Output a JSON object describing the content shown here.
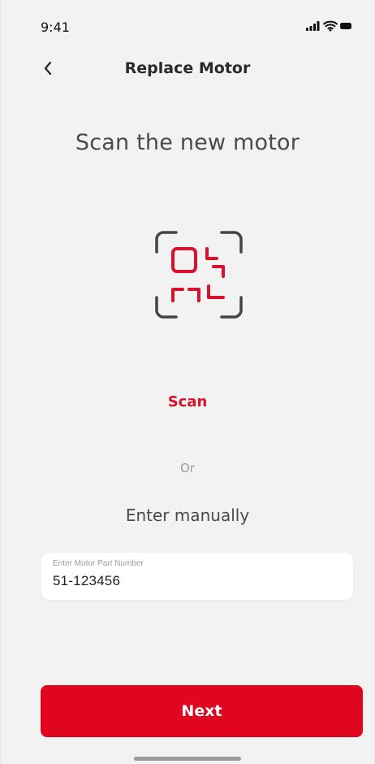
{
  "status_bar": {
    "time": "9:41",
    "icons": [
      "signal-icon",
      "wifi-icon",
      "battery-icon"
    ]
  },
  "header": {
    "title": "Replace Motor",
    "back_icon": "chevron-left-icon"
  },
  "main": {
    "title": "Scan the new motor",
    "scan_icon": "qr-scan-icon",
    "scan_label": "Scan",
    "or_label": "Or",
    "enter_manually_label": "Enter manually"
  },
  "input": {
    "label": "Enter Motor Part Number",
    "value": "51-123456"
  },
  "footer": {
    "next_label": "Next"
  },
  "colors": {
    "accent": "#e1061f",
    "background": "#f2f2f2",
    "text_primary": "#2a2a2a",
    "text_secondary": "#4a4a4a",
    "muted": "#9a9a9a"
  }
}
